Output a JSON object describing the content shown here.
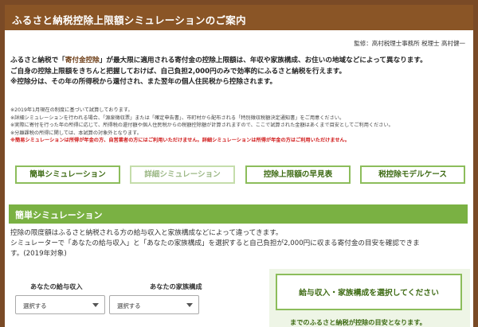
{
  "header": {
    "title": "ふるさと納税控除上限額シミュレーションのご案内"
  },
  "supervisor": "監修：高村税理士事務所 税理士 高村健一",
  "lead": {
    "line1_pre": "ふるさと納税で「",
    "line1_hl": "寄付金控除",
    "line1_post": "」が最大限に適用される寄付金の控除上限額は、年収や家族構成、お住いの地域などによって異なります。",
    "line2": "ご自身の控除上限額をきちんと把握しておけば、自己負担2,000円のみで効率的にふるさと納税を行えます。",
    "line3": "※控除分は、その年の所得税から還付され、また翌年の個人住民税から控除されます。"
  },
  "notes": [
    "※2019年1月現在の制度に基づいて試算しております。",
    "※詳細シミュレーションを行われる場合、「源泉徴収票」または「確定申告書」、市町村から配布される「特別徴収税額決定通知書」をご用意ください。",
    "※実際に寄付を行った年の所得に応じて、所得税の還付額や個人住民税からの税額控除額が計算されますので、ここで試算された金額はあくまで目安としてご利用ください。",
    "※分離課税の所得に関しては、本試算の対象外となります。"
  ],
  "notes_warning": "※簡易シミュレーションは所得が年金の方、自営業者の方にはご利用いただけません。詳細シミュレーションは所得が年金の方はご利用いただけません。",
  "tabs": [
    {
      "label": "簡単シミュレーション",
      "disabled": false
    },
    {
      "label": "詳細シミュレーション",
      "disabled": true
    },
    {
      "label": "控除上限額の早見表",
      "disabled": false
    },
    {
      "label": "税控除モデルケース",
      "disabled": false
    }
  ],
  "section": {
    "title": "簡単シミュレーション"
  },
  "description": {
    "line1": "控除の限度額はふるさと納税される方の給与収入と家族構成などによって違ってきます。",
    "line2": "シミュレーターで「あなたの給与収入」と「あなたの家族構成」を選択すると自己負担が2,000円に収まる寄付金の目安を確認できま",
    "line3": "す。(2019年対象)"
  },
  "form": {
    "income_label": "あなたの給与収入",
    "income_select": "選択する",
    "family_label": "あなたの家族構成",
    "family_select": "選択する"
  },
  "result": {
    "prompt": "給与収入・家族構成を選択してください",
    "note": "までのふるさと納税が控除の目安となります。"
  },
  "colors": {
    "brown": "#8a5526",
    "green": "#7ab143",
    "green_border": "#8cbd5b",
    "warning_red": "#d01919"
  }
}
